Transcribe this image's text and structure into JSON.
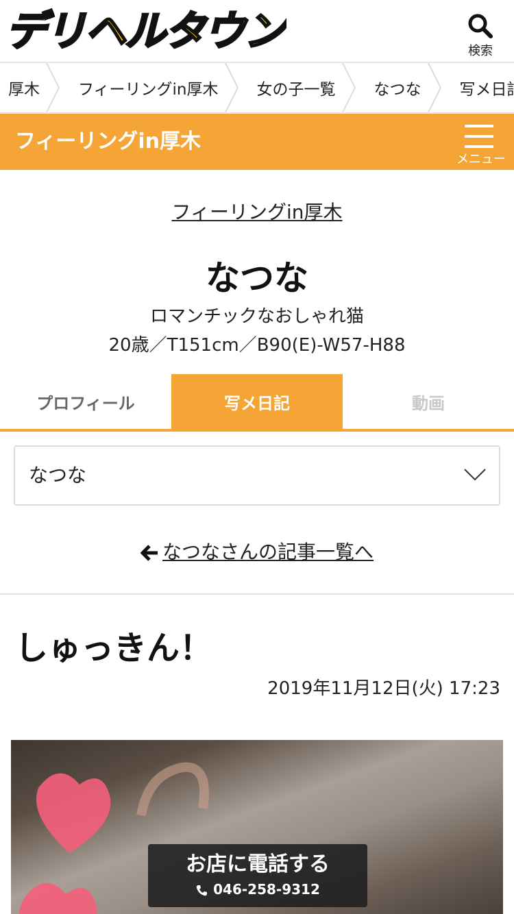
{
  "header": {
    "logo_text": "デリヘルタウン",
    "search_label": "検索"
  },
  "breadcrumb": [
    "厚木",
    "フィーリングin厚木",
    "女の子一覧",
    "なつな",
    "写メ日記"
  ],
  "shopbar": {
    "title": "フィーリングin厚木",
    "menu_label": "メニュー"
  },
  "profile": {
    "shop_link": "フィーリングin厚木",
    "name": "なつな",
    "catch": "ロマンチックなおしゃれ猫",
    "spec": "20歳／T151cm／B90(E)-W57-H88"
  },
  "tabs": [
    "プロフィール",
    "写メ日記",
    "動画"
  ],
  "select": {
    "value": "なつな"
  },
  "back_link": "なつなさんの記事一覧へ",
  "post": {
    "title": "しゅっきん！",
    "date": "2019年11月12日(火) 17:23"
  },
  "call": {
    "label": "お店に電話する",
    "number": "046-258-9312"
  },
  "colors": {
    "accent": "#f4a535",
    "logo_yellow": "#ffd400"
  },
  "icons": {
    "search": "search-icon",
    "menu": "hamburger-icon",
    "chevron": "chevron-down-icon",
    "back": "arrow-left-icon",
    "phone": "phone-icon"
  }
}
